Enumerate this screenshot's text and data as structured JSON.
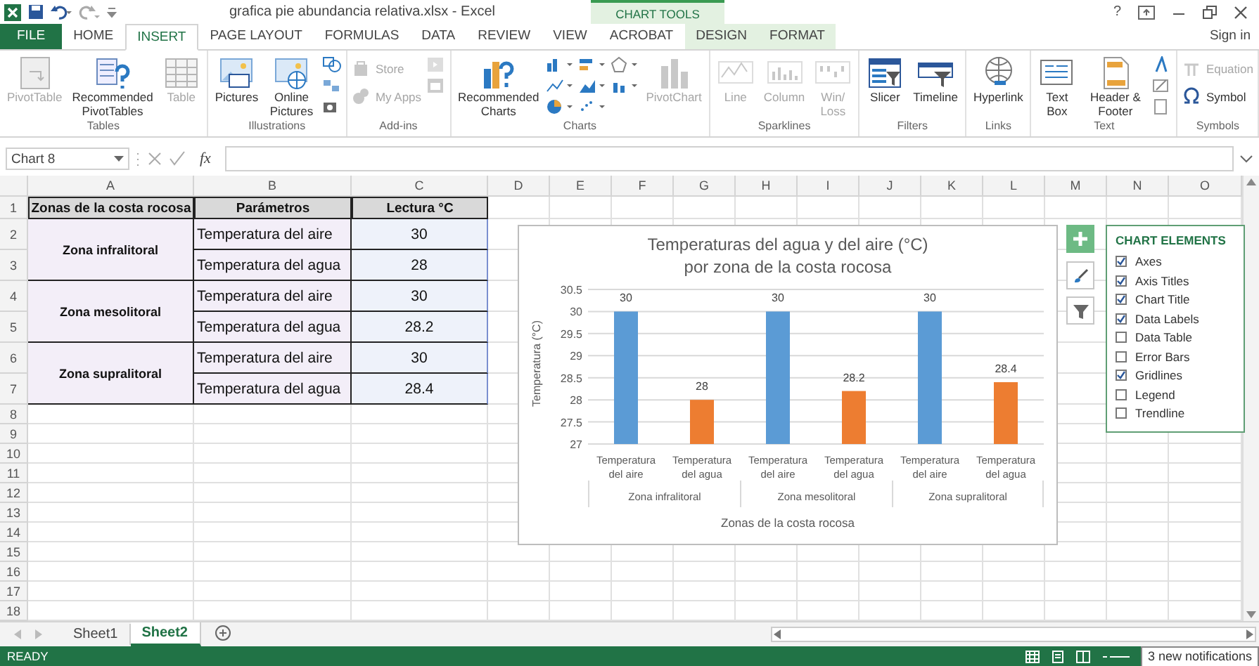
{
  "window": {
    "title": "grafica pie abundancia relativa.xlsx - Excel",
    "help": "?",
    "sign_in": "Sign in"
  },
  "contextual": {
    "label": "CHART TOOLS"
  },
  "tabs": [
    {
      "label": "FILE",
      "kind": "file",
      "selected": false
    },
    {
      "label": "HOME",
      "kind": "normal",
      "selected": false
    },
    {
      "label": "INSERT",
      "kind": "normal",
      "selected": true
    },
    {
      "label": "PAGE LAYOUT",
      "kind": "normal",
      "selected": false
    },
    {
      "label": "FORMULAS",
      "kind": "normal",
      "selected": false
    },
    {
      "label": "DATA",
      "kind": "normal",
      "selected": false
    },
    {
      "label": "REVIEW",
      "kind": "normal",
      "selected": false
    },
    {
      "label": "VIEW",
      "kind": "normal",
      "selected": false
    },
    {
      "label": "ACROBAT",
      "kind": "normal",
      "selected": false
    },
    {
      "label": "DESIGN",
      "kind": "contextual",
      "selected": false
    },
    {
      "label": "FORMAT",
      "kind": "contextual",
      "selected": false
    }
  ],
  "ribbon": {
    "groups": [
      {
        "label": "Tables",
        "items": [
          {
            "label": "PivotTable",
            "kind": "large",
            "disabled": true
          },
          {
            "label": "Recommended PivotTables",
            "kind": "large",
            "disabled": false
          },
          {
            "label": "Table",
            "kind": "large",
            "disabled": true
          }
        ]
      },
      {
        "label": "Illustrations",
        "items": [
          {
            "label": "Pictures",
            "kind": "large",
            "disabled": false
          },
          {
            "label": "Online Pictures",
            "kind": "large",
            "disabled": false
          }
        ]
      },
      {
        "label": "Add-ins",
        "items": [
          {
            "label": "Store",
            "kind": "small",
            "disabled": true
          },
          {
            "label": "My Apps",
            "kind": "small",
            "disabled": true
          }
        ]
      },
      {
        "label": "Charts",
        "items": [
          {
            "label": "Recommended Charts",
            "kind": "large",
            "disabled": false
          },
          {
            "label": "PivotChart",
            "kind": "large",
            "disabled": true
          }
        ]
      },
      {
        "label": "Sparklines",
        "items": [
          {
            "label": "Line",
            "kind": "large",
            "disabled": true
          },
          {
            "label": "Column",
            "kind": "large",
            "disabled": true
          },
          {
            "label": "Win/ Loss",
            "kind": "large",
            "disabled": true
          }
        ]
      },
      {
        "label": "Filters",
        "items": [
          {
            "label": "Slicer",
            "kind": "large",
            "disabled": false
          },
          {
            "label": "Timeline",
            "kind": "large",
            "disabled": false
          }
        ]
      },
      {
        "label": "Links",
        "items": [
          {
            "label": "Hyperlink",
            "kind": "large",
            "disabled": false
          }
        ]
      },
      {
        "label": "Text",
        "items": [
          {
            "label": "Text Box",
            "kind": "large",
            "disabled": false
          },
          {
            "label": "Header & Footer",
            "kind": "large",
            "disabled": false
          }
        ]
      },
      {
        "label": "Symbols",
        "items": [
          {
            "label": "Equation",
            "kind": "small",
            "disabled": true
          },
          {
            "label": "Symbol",
            "kind": "small",
            "disabled": false
          }
        ]
      }
    ]
  },
  "formula_bar": {
    "name_box": "Chart 8",
    "function_label": "fx"
  },
  "sheet": {
    "columns": [
      "A",
      "B",
      "C",
      "D",
      "E",
      "F",
      "G",
      "H",
      "I",
      "J",
      "K",
      "L",
      "M",
      "N",
      "O"
    ],
    "row_numbers": [
      "1",
      "2",
      "3",
      "4",
      "5",
      "6",
      "7",
      "8",
      "9",
      "10",
      "11",
      "12",
      "13",
      "14",
      "15",
      "16",
      "17",
      "18"
    ],
    "headers": [
      "Zonas de la costa rocosa",
      "Parámetros",
      "Lectura °C"
    ],
    "zones": [
      {
        "name": "Zona infralitoral",
        "rows": [
          {
            "parameter": "Temperatura del aire",
            "reading": "30"
          },
          {
            "parameter": "Temperatura del agua",
            "reading": "28"
          }
        ]
      },
      {
        "name": "Zona mesolitoral",
        "rows": [
          {
            "parameter": "Temperatura del aire",
            "reading": "30"
          },
          {
            "parameter": "Temperatura del agua",
            "reading": "28.2"
          }
        ]
      },
      {
        "name": "Zona supralitoral",
        "rows": [
          {
            "parameter": "Temperatura del aire",
            "reading": "30"
          },
          {
            "parameter": "Temperatura del agua",
            "reading": "28.4"
          }
        ]
      }
    ]
  },
  "chart": {
    "chart_data": {
      "type": "bar",
      "title": "Temperaturas del agua y del aire (°C) por zona de la costa rocosa",
      "xlabel": "Zonas de la costa rocosa",
      "ylabel": "Temperatura (°C)",
      "categories": [
        "Temperatura del aire",
        "Temperatura del agua",
        "Temperatura del aire",
        "Temperatura del agua",
        "Temperatura del aire",
        "Temperatura del agua"
      ],
      "series": [
        {
          "color": "#5b9bd5",
          "values": [
            30,
            null,
            30,
            null,
            30,
            null
          ]
        },
        {
          "color": "#ed7d31",
          "values": [
            null,
            28,
            null,
            28.2,
            null,
            28.4
          ]
        }
      ],
      "grid": true,
      "ylim": [
        27,
        30.5
      ],
      "yticks": [
        27,
        27.5,
        28,
        28.5,
        29,
        29.5,
        30,
        30.5
      ],
      "data_labels": true
    },
    "category_groups": [
      "Zona infralitoral",
      "Zona mesolitoral",
      "Zona supralitoral"
    ]
  },
  "chart_elements": {
    "title": "CHART ELEMENTS",
    "items": [
      {
        "label": "Axes",
        "checked": true
      },
      {
        "label": "Axis Titles",
        "checked": true
      },
      {
        "label": "Chart Title",
        "checked": true
      },
      {
        "label": "Data Labels",
        "checked": true
      },
      {
        "label": "Data Table",
        "checked": false
      },
      {
        "label": "Error Bars",
        "checked": false
      },
      {
        "label": "Gridlines",
        "checked": true
      },
      {
        "label": "Legend",
        "checked": false
      },
      {
        "label": "Trendline",
        "checked": false
      }
    ]
  },
  "sheet_tabs": [
    {
      "label": "Sheet1",
      "selected": false
    },
    {
      "label": "Sheet2",
      "selected": true
    }
  ],
  "status_bar": {
    "mode": "READY",
    "notification": "3 new notifications"
  }
}
